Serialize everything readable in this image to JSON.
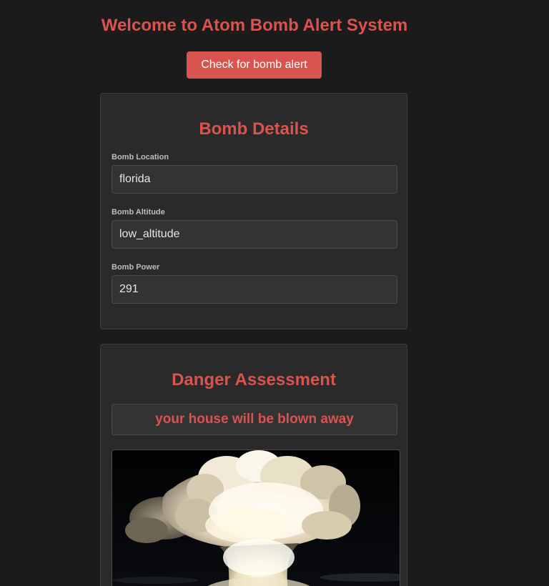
{
  "header": {
    "title": "Welcome to Atom Bomb Alert System",
    "check_button_label": "Check for bomb alert"
  },
  "bomb_details": {
    "title": "Bomb Details",
    "fields": [
      {
        "label": "Bomb Location",
        "value": "florida"
      },
      {
        "label": "Bomb Altitude",
        "value": "low_altitude"
      },
      {
        "label": "Bomb Power",
        "value": "291"
      }
    ]
  },
  "danger_assessment": {
    "title": "Danger Assessment",
    "message": "your house will be blown away",
    "image": {
      "subject": "mushroom-cloud-explosion"
    }
  },
  "colors": {
    "accent": "#d9534f",
    "background": "#1b1b1b",
    "card": "#2a2a2a"
  }
}
